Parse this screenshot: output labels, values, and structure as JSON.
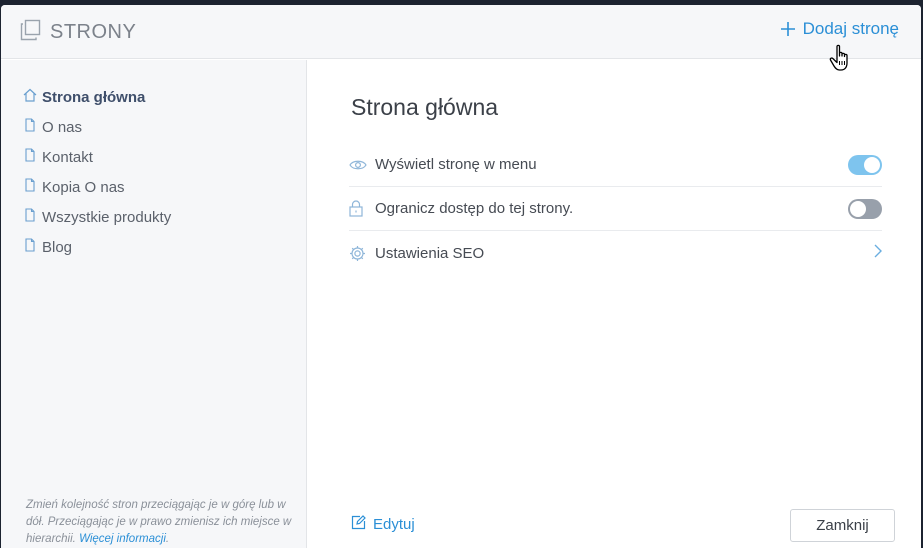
{
  "header": {
    "title": "STRONY",
    "add_page_label": "Dodaj stronę",
    "add_page_icon": "plus-icon",
    "title_icon": "pages-icon"
  },
  "sidebar": {
    "items": [
      {
        "label": "Strona główna",
        "icon": "home-icon",
        "active": true
      },
      {
        "label": "O nas",
        "icon": "page-icon",
        "active": false
      },
      {
        "label": "Kontakt",
        "icon": "page-icon",
        "active": false
      },
      {
        "label": "Kopia O nas",
        "icon": "page-icon",
        "active": false
      },
      {
        "label": "Wszystkie produkty",
        "icon": "page-icon",
        "active": false
      },
      {
        "label": "Blog",
        "icon": "page-icon",
        "active": false
      }
    ],
    "hint_text": "Zmień kolejność stron przeciągając je w górę lub w dół. Przeciągając je w prawo zmienisz ich miejsce w hierarchii. ",
    "hint_link": "Więcej informacji",
    "hint_end": "."
  },
  "main": {
    "heading": "Strona główna",
    "settings": [
      {
        "label": "Wyświetl stronę w menu",
        "icon": "eye-icon",
        "control": "toggle",
        "value": true
      },
      {
        "label": "Ogranicz dostęp do tej strony.",
        "icon": "lock-icon",
        "control": "toggle",
        "value": false
      },
      {
        "label": "Ustawienia SEO",
        "icon": "gear-icon",
        "control": "chevron"
      }
    ],
    "edit_label": "Edytuj",
    "close_label": "Zamknij"
  },
  "colors": {
    "accent": "#2b8fd6",
    "toggle_on": "#7ec4ee",
    "toggle_off": "#98a0ab",
    "panel_bg": "#f6f7f9"
  }
}
